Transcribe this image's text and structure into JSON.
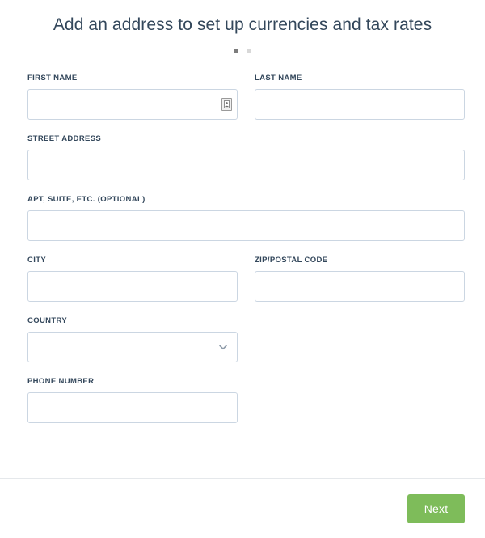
{
  "header": {
    "title": "Add an address to set up currencies and tax rates",
    "steps": [
      {
        "name": "step-1",
        "active": true
      },
      {
        "name": "step-2",
        "active": false
      }
    ]
  },
  "form": {
    "first_name": {
      "label": "FIRST NAME",
      "value": "",
      "placeholder": "",
      "icon": "autofill-contact-icon"
    },
    "last_name": {
      "label": "LAST NAME",
      "value": "",
      "placeholder": ""
    },
    "street_address": {
      "label": "STREET ADDRESS",
      "value": "",
      "placeholder": ""
    },
    "apt_suite": {
      "label": "APT, SUITE, ETC. (OPTIONAL)",
      "value": "",
      "placeholder": ""
    },
    "city": {
      "label": "CITY",
      "value": "",
      "placeholder": ""
    },
    "zip_postal_code": {
      "label": "ZIP/POSTAL CODE",
      "value": "",
      "placeholder": ""
    },
    "country": {
      "label": "COUNTRY",
      "value": "",
      "placeholder": "",
      "icon": "chevron-down-icon",
      "options": [
        ""
      ]
    },
    "phone_number": {
      "label": "PHONE NUMBER",
      "value": "",
      "placeholder": ""
    }
  },
  "footer": {
    "next_label": "Next"
  },
  "colors": {
    "accent_green": "#7ebc5a",
    "title_text": "#33475b",
    "label_text": "#33475b",
    "input_border": "#cbd6e2",
    "divider": "#e5e8eb",
    "dot_active": "#7c7c7c",
    "dot_inactive": "#d8d8d8",
    "page_background": "#ffffff"
  }
}
